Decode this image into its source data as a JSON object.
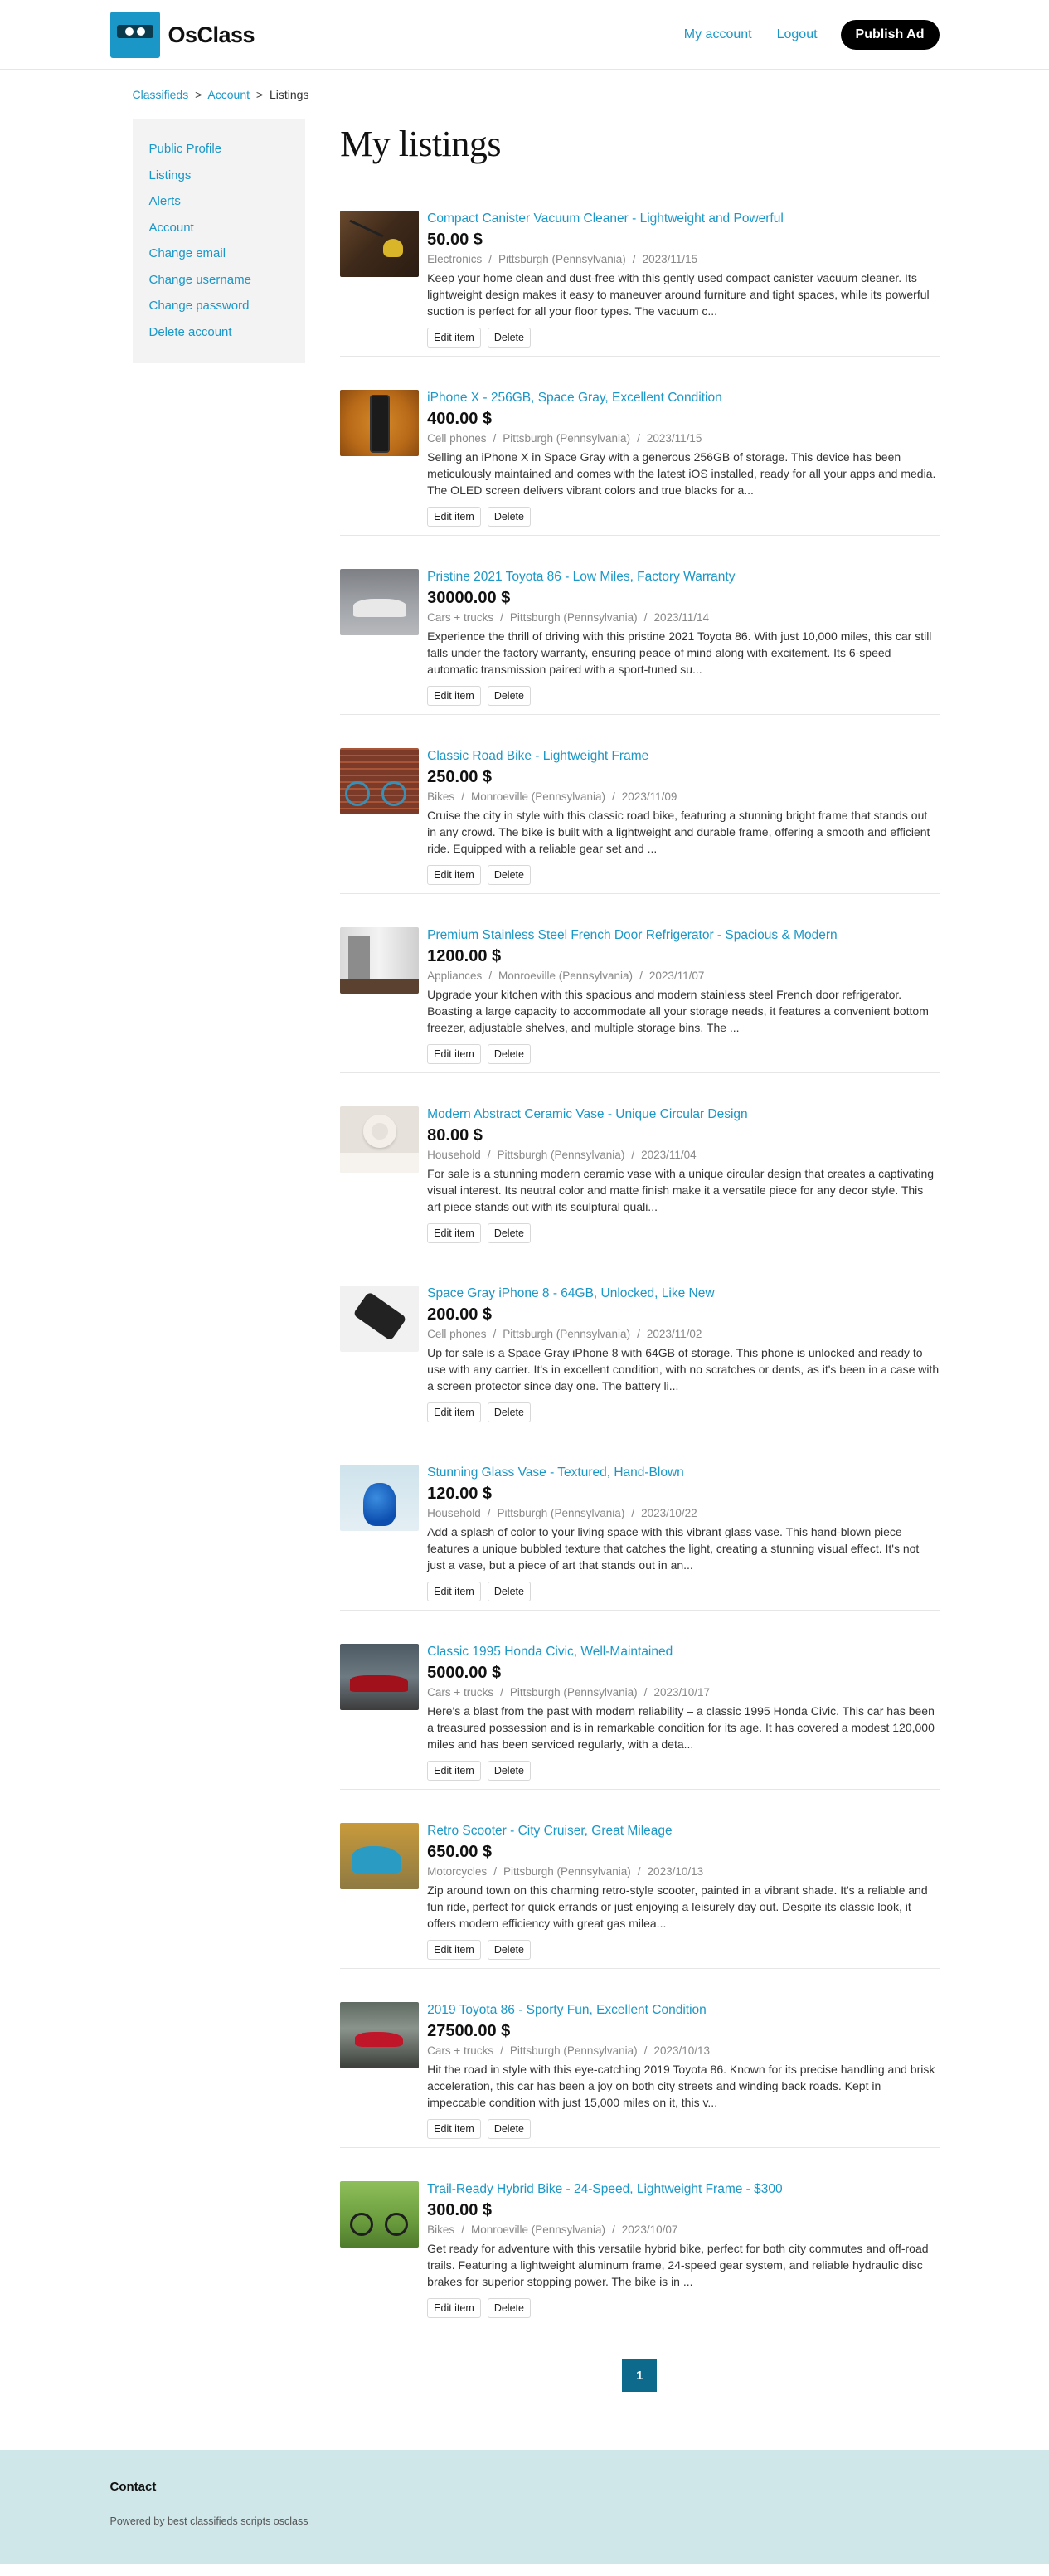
{
  "header": {
    "logo_text": "OsClass",
    "nav": {
      "my_account": "My account",
      "logout": "Logout",
      "publish": "Publish Ad"
    }
  },
  "breadcrumb": {
    "home": "Classifieds",
    "sep1": ">",
    "account": "Account",
    "sep2": ">",
    "current": "Listings"
  },
  "sidebar": {
    "items": [
      {
        "label": "Public Profile"
      },
      {
        "label": "Listings"
      },
      {
        "label": "Alerts"
      },
      {
        "label": "Account"
      },
      {
        "label": "Change email"
      },
      {
        "label": "Change username"
      },
      {
        "label": "Change password"
      },
      {
        "label": "Delete account"
      }
    ]
  },
  "main": {
    "title": "My listings",
    "edit_label": "Edit item",
    "delete_label": "Delete",
    "listings": [
      {
        "title": "Compact Canister Vacuum Cleaner - Lightweight and Powerful",
        "price": "50.00 $",
        "category": "Electronics",
        "location": "Pittsburgh (Pennsylvania)",
        "date": "2023/11/15",
        "description": "Keep your home clean and dust-free with this gently used compact canister vacuum cleaner. Its lightweight design makes it easy to maneuver around furniture and tight spaces, while its powerful suction is perfect for all your floor types. The vacuum c..."
      },
      {
        "title": "iPhone X - 256GB, Space Gray, Excellent Condition",
        "price": "400.00 $",
        "category": "Cell phones",
        "location": "Pittsburgh (Pennsylvania)",
        "date": "2023/11/15",
        "description": "Selling an iPhone X in Space Gray with a generous 256GB of storage. This device has been meticulously maintained and comes with the latest iOS installed, ready for all your apps and media. The OLED screen delivers vibrant colors and true blacks for a..."
      },
      {
        "title": "Pristine 2021 Toyota 86 - Low Miles, Factory Warranty",
        "price": "30000.00 $",
        "category": "Cars + trucks",
        "location": "Pittsburgh (Pennsylvania)",
        "date": "2023/11/14",
        "description": "Experience the thrill of driving with this pristine 2021 Toyota 86. With just 10,000 miles, this car still falls under the factory warranty, ensuring peace of mind along with excitement. Its 6-speed automatic transmission paired with a sport-tuned su..."
      },
      {
        "title": "Classic Road Bike - Lightweight Frame",
        "price": "250.00 $",
        "category": "Bikes",
        "location": "Monroeville (Pennsylvania)",
        "date": "2023/11/09",
        "description": "Cruise the city in style with this classic road bike, featuring a stunning bright frame that stands out in any crowd. The bike is built with a lightweight and durable frame, offering a smooth and efficient ride. Equipped with a reliable gear set and ..."
      },
      {
        "title": "Premium Stainless Steel French Door Refrigerator - Spacious & Modern",
        "price": "1200.00 $",
        "category": "Appliances",
        "location": "Monroeville (Pennsylvania)",
        "date": "2023/11/07",
        "description": "Upgrade your kitchen with this spacious and modern stainless steel French door refrigerator. Boasting a large capacity to accommodate all your storage needs, it features a convenient bottom freezer, adjustable shelves, and multiple storage bins. The ..."
      },
      {
        "title": "Modern Abstract Ceramic Vase - Unique Circular Design",
        "price": "80.00 $",
        "category": "Household",
        "location": "Pittsburgh (Pennsylvania)",
        "date": "2023/11/04",
        "description": "For sale is a stunning modern ceramic vase with a unique circular design that creates a captivating visual interest. Its neutral color and matte finish make it a versatile piece for any decor style. This art piece stands out with its sculptural quali..."
      },
      {
        "title": "Space Gray iPhone 8 - 64GB, Unlocked, Like New",
        "price": "200.00 $",
        "category": "Cell phones",
        "location": "Pittsburgh (Pennsylvania)",
        "date": "2023/11/02",
        "description": "Up for sale is a Space Gray iPhone 8 with 64GB of storage. This phone is unlocked and ready to use with any carrier. It's in excellent condition, with no scratches or dents, as it's been in a case with a screen protector since day one. The battery li..."
      },
      {
        "title": "Stunning Glass Vase - Textured, Hand-Blown",
        "price": "120.00 $",
        "category": "Household",
        "location": "Pittsburgh (Pennsylvania)",
        "date": "2023/10/22",
        "description": "Add a splash of color to your living space with this vibrant glass vase. This hand-blown piece features a unique bubbled texture that catches the light, creating a stunning visual effect. It's not just a vase, but a piece of art that stands out in an..."
      },
      {
        "title": "Classic 1995 Honda Civic, Well-Maintained",
        "price": "5000.00 $",
        "category": "Cars + trucks",
        "location": "Pittsburgh (Pennsylvania)",
        "date": "2023/10/17",
        "description": "Here's a blast from the past with modern reliability – a classic 1995 Honda Civic. This car has been a treasured possession and is in remarkable condition for its age. It has covered a modest 120,000 miles and has been serviced regularly, with a deta..."
      },
      {
        "title": "Retro Scooter - City Cruiser, Great Mileage",
        "price": "650.00 $",
        "category": "Motorcycles",
        "location": "Pittsburgh (Pennsylvania)",
        "date": "2023/10/13",
        "description": "Zip around town on this charming retro-style scooter, painted in a vibrant shade. It's a reliable and fun ride, perfect for quick errands or just enjoying a leisurely day out. Despite its classic look, it offers modern efficiency with great gas milea..."
      },
      {
        "title": "2019 Toyota 86 - Sporty Fun, Excellent Condition",
        "price": "27500.00 $",
        "category": "Cars + trucks",
        "location": "Pittsburgh (Pennsylvania)",
        "date": "2023/10/13",
        "description": "Hit the road in style with this eye-catching 2019 Toyota 86. Known for its precise handling and brisk acceleration, this car has been a joy on both city streets and winding back roads. Kept in impeccable condition with just 15,000 miles on it, this v..."
      },
      {
        "title": "Trail-Ready Hybrid Bike - 24-Speed, Lightweight Frame - $300",
        "price": "300.00 $",
        "category": "Bikes",
        "location": "Monroeville (Pennsylvania)",
        "date": "2023/10/07",
        "description": "Get ready for adventure with this versatile hybrid bike, perfect for both city commutes and off-road trails. Featuring a lightweight aluminum frame, 24-speed gear system, and reliable hydraulic disc brakes for superior stopping power. The bike is in ..."
      }
    ]
  },
  "pagination": {
    "current": "1"
  },
  "footer": {
    "title": "Contact",
    "note": "Powered by best classifieds scripts osclass"
  }
}
